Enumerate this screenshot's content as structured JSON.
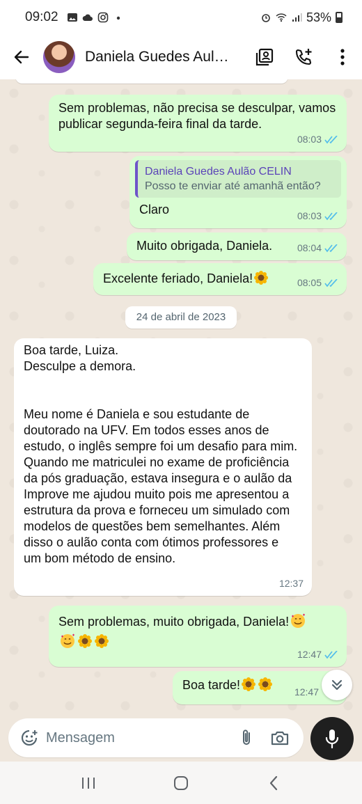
{
  "status_bar": {
    "time": "09:02",
    "battery": "53%"
  },
  "header": {
    "contact_name": "Daniela Guedes Aulã…",
    "icons": [
      "back-arrow-icon",
      "contact-card-icon",
      "add-call-icon",
      "more-vertical-icon"
    ]
  },
  "chat": {
    "date_separator": "24 de abril de 2023",
    "messages": [
      {
        "direction": "out",
        "text": "Sem problemas, não precisa se desculpar, vamos publicar segunda-feira final da tarde.",
        "time": "08:03",
        "status": "read"
      },
      {
        "direction": "out",
        "quote_name": "Daniela Guedes Aulão CELIN",
        "quote_text": "Posso te enviar até amanhã então?",
        "text": "Claro",
        "time": "08:03",
        "status": "read"
      },
      {
        "direction": "out",
        "text": "Muito obrigada, Daniela.",
        "time": "08:04",
        "status": "read"
      },
      {
        "direction": "out",
        "text": "Excelente feriado, Daniela!",
        "emojis": [
          "sunflower"
        ],
        "time": "08:05",
        "status": "read"
      },
      {
        "direction": "in",
        "greeting_line1": "Boa tarde, Luiza.",
        "greeting_line2": "Desculpe a demora.",
        "body": "Meu nome é Daniela e sou estudante de doutorado na UFV.  Em todos esses anos de estudo, o inglês sempre foi um desafio para mim. Quando me matriculei no exame de proficiência da pós graduação, estava insegura e o aulão da Improve me ajudou muito pois me apresentou a estrutura da prova e forneceu um simulado com modelos de questões bem semelhantes. Além disso o aulão conta com ótimos professores e um bom método de ensino.",
        "time": "12:37"
      },
      {
        "direction": "out",
        "text": "Sem problemas, muito obrigada, Daniela!",
        "emojis": [
          "smiling-face-with-hearts",
          "smiling-face-with-hearts",
          "sunflower",
          "sunflower"
        ],
        "time": "12:47",
        "status": "read"
      },
      {
        "direction": "out",
        "text": "Boa tarde!",
        "emojis": [
          "sunflower",
          "sunflower"
        ],
        "time": "12:47",
        "status": "read"
      }
    ]
  },
  "composer": {
    "placeholder": "Mensagem",
    "icons": [
      "emoji-icon",
      "attach-icon",
      "camera-icon",
      "mic-icon"
    ]
  },
  "colors": {
    "outgoing_bubble": "#d9fdd3",
    "incoming_bubble": "#ffffff",
    "read_ticks": "#53bdeb",
    "quote_accent": "#6e55c9",
    "chat_background": "#efe7dd"
  }
}
